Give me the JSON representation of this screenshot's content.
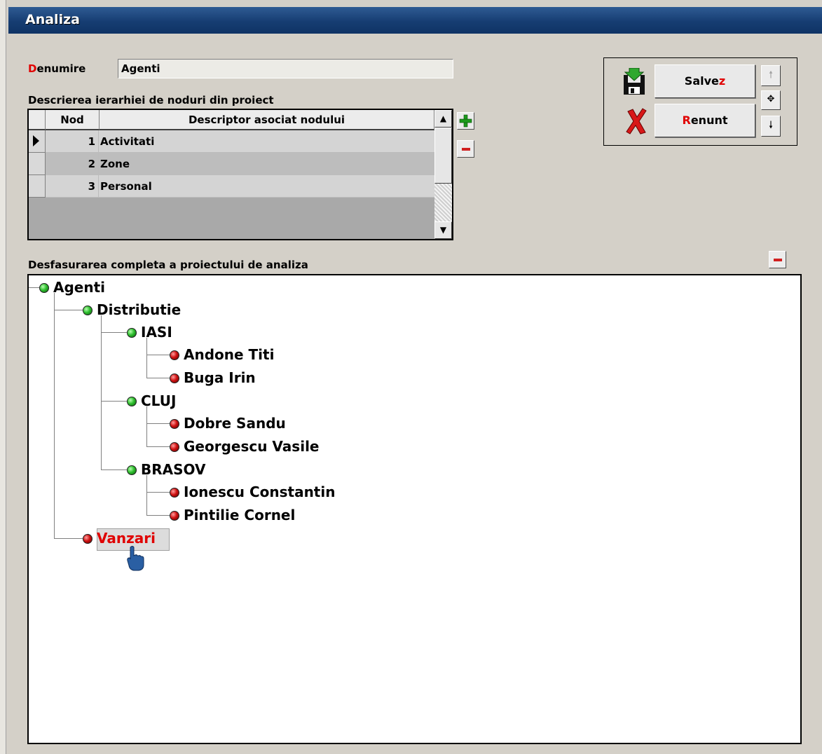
{
  "window": {
    "title": "Analiza"
  },
  "form": {
    "denumire_hot": "D",
    "denumire_rest": "enumire",
    "denumire_value": "Agenti",
    "hierarchy_label": "Descrierea ierarhiei de noduri din proiect"
  },
  "grid": {
    "col_nod": "Nod",
    "col_desc": "Descriptor asociat nodului",
    "rows": [
      {
        "nod": "1",
        "desc": "Activitati",
        "selected": true
      },
      {
        "nod": "2",
        "desc": "Zone",
        "selected": false
      },
      {
        "nod": "3",
        "desc": "Personal",
        "selected": false
      }
    ]
  },
  "actions": {
    "save_label": "Salve",
    "save_hot": "z",
    "cancel_hot": "R",
    "cancel_label": "enunt"
  },
  "tree": {
    "label": "Desfasurarea completa a proiectului de analiza",
    "nodes": {
      "root": "Agenti",
      "distributie": "Distributie",
      "iasi": "IASI",
      "andone": "Andone Titi",
      "buga": "Buga Irin",
      "cluj": "CLUJ",
      "dobre": "Dobre Sandu",
      "georgescu": "Georgescu Vasile",
      "brasov": "BRASOV",
      "ionescu": "Ionescu Constantin",
      "pintilie": "Pintilie Cornel",
      "vanzari": "Vanzari"
    }
  },
  "colors": {
    "title_bar": "#163d72",
    "hotkey": "#e00000",
    "node_green": "#2fbf2f",
    "node_red": "#d01212"
  },
  "icons": [
    "plus-icon",
    "minus-icon",
    "save-disk-icon",
    "cancel-x-icon",
    "arrow-up-icon",
    "move-icon",
    "arrow-down-icon",
    "hand-cursor-icon"
  ]
}
